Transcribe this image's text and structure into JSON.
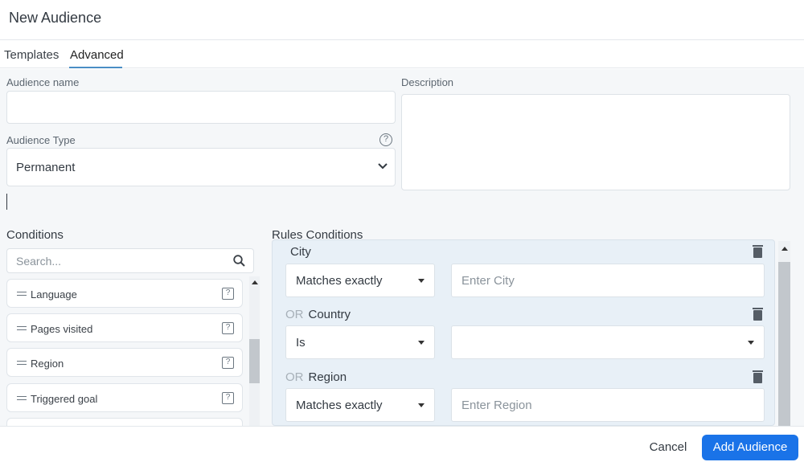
{
  "dialog": {
    "title": "New Audience"
  },
  "tabs": [
    {
      "label": "Templates"
    },
    {
      "label": "Advanced"
    }
  ],
  "form": {
    "audience_name_label": "Audience name",
    "audience_name_value": "",
    "description_label": "Description",
    "description_value": "",
    "audience_type_label": "Audience Type",
    "audience_type_value": "Permanent"
  },
  "conditions": {
    "title": "Conditions",
    "search_placeholder": "Search...",
    "items": [
      {
        "label": "Language"
      },
      {
        "label": "Pages visited"
      },
      {
        "label": "Region"
      },
      {
        "label": "Triggered goal"
      }
    ]
  },
  "rules": {
    "title": "Rules Conditions",
    "items": [
      {
        "connector": "",
        "field": "City",
        "operator": "Matches exactly",
        "value_placeholder": "Enter City"
      },
      {
        "connector": "OR",
        "field": "Country",
        "operator": "Is",
        "value_placeholder": ""
      },
      {
        "connector": "OR",
        "field": "Region",
        "operator": "Matches exactly",
        "value_placeholder": "Enter Region"
      }
    ]
  },
  "footer": {
    "cancel_label": "Cancel",
    "add_label": "Add Audience"
  },
  "colors": {
    "primary": "#1a73e8",
    "tab_underline": "#4a8ec5",
    "rules_panel_bg": "#e8f0f7"
  }
}
